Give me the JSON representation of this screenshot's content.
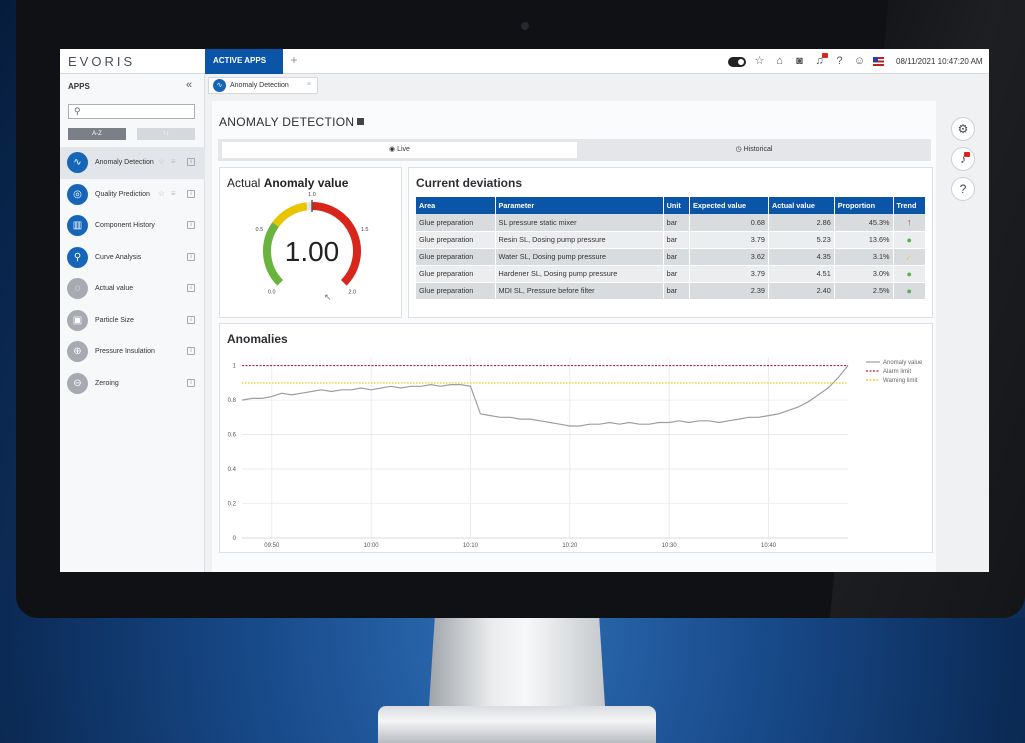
{
  "topbar": {
    "brand": "EVORIS",
    "active_tab": "ACTIVE APPS",
    "add_tab": "+",
    "datetime": "08/11/2021 10:47:20 AM",
    "icons": [
      "toggle-icon",
      "star-icon",
      "home-icon",
      "camera-icon",
      "notification-icon",
      "help-icon",
      "user-icon",
      "flag-icon"
    ]
  },
  "sidebar": {
    "title": "APPS",
    "collapse": "«",
    "sort_az": "A-Z",
    "sort_alt": "↑↓",
    "items": [
      {
        "label": "Anomaly Detection",
        "icon": "anomaly-icon",
        "active": true
      },
      {
        "label": "Quality Prediction",
        "icon": "quality-icon"
      },
      {
        "label": "Component History",
        "icon": "component-history-icon"
      },
      {
        "label": "Curve Analysis",
        "icon": "curve-analysis-icon"
      },
      {
        "label": "Actual value",
        "icon": "actual-value-icon",
        "grey": true
      },
      {
        "label": "Particle Size",
        "icon": "particle-size-icon",
        "grey": true
      },
      {
        "label": "Pressure Insulation",
        "icon": "pressure-insulation-icon",
        "grey": true
      },
      {
        "label": "Zeroing",
        "icon": "zeroing-icon",
        "grey": true
      }
    ]
  },
  "subtab": {
    "label": "Anomaly Detection",
    "close": "×"
  },
  "page": {
    "title": "ANOMALY DETECTION",
    "mode_live": "Live",
    "mode_historical": "Historical"
  },
  "gauge": {
    "title_prefix": "Actual ",
    "title_bold": "Anomaly value",
    "value_text": "1.00",
    "value": 1.0,
    "min": 0.0,
    "max": 2.0,
    "ticks": [
      "0.0",
      "0.5",
      "1.0",
      "1.5",
      "2.0"
    ],
    "colors": {
      "low": "#6ab43e",
      "mid": "#e9c500",
      "high": "#d9261c",
      "track": "#e2e4e7"
    }
  },
  "deviations": {
    "title": "Current deviations",
    "columns": [
      "Area",
      "Parameter",
      "Unit",
      "Expected value",
      "Actual value",
      "Proportion",
      "Trend"
    ],
    "rows": [
      {
        "area": "Glue preparation",
        "parameter": "SL pressure static mixer",
        "unit": "bar",
        "expected": "0.68",
        "actual": "2.86",
        "proportion": "45.3%",
        "trend": "up"
      },
      {
        "area": "Glue preparation",
        "parameter": "Resin SL, Dosing pump pressure",
        "unit": "bar",
        "expected": "3.79",
        "actual": "5.23",
        "proportion": "13.6%",
        "trend": "dot"
      },
      {
        "area": "Glue preparation",
        "parameter": "Water SL, Dosing pump pressure",
        "unit": "bar",
        "expected": "3.62",
        "actual": "4.35",
        "proportion": "3.1%",
        "trend": "diag"
      },
      {
        "area": "Glue preparation",
        "parameter": "Hardener SL, Dosing pump pressure",
        "unit": "bar",
        "expected": "3.79",
        "actual": "4.51",
        "proportion": "3.0%",
        "trend": "dot"
      },
      {
        "area": "Glue preparation",
        "parameter": "MDI SL, Pressure before filter",
        "unit": "bar",
        "expected": "2.39",
        "actual": "2.40",
        "proportion": "2.5%",
        "trend": "dot"
      }
    ]
  },
  "chart_data": {
    "type": "line",
    "title": "Anomalies",
    "xlabel": "",
    "ylabel": "",
    "x_ticks": [
      "09:50",
      "10:00",
      "10:10",
      "10:20",
      "10:30",
      "10:40"
    ],
    "x_range_minutes": [
      47,
      108
    ],
    "x_tick_minutes": [
      50,
      60,
      70,
      80,
      90,
      100
    ],
    "ylim": [
      0,
      1.05
    ],
    "y_ticks": [
      "0",
      "0.2",
      "0.4",
      "0.6",
      "0.8",
      "1"
    ],
    "grid": true,
    "legend_position": "right",
    "series": [
      {
        "name": "Anomaly value",
        "color": "#9a9ea4",
        "x": [
          47,
          48,
          49,
          50,
          51,
          52,
          53,
          54,
          55,
          56,
          57,
          58,
          59,
          60,
          61,
          62,
          63,
          64,
          65,
          66,
          67,
          68,
          69,
          70,
          70.5,
          71,
          72,
          73,
          74,
          75,
          76,
          77,
          78,
          79,
          80,
          81,
          82,
          83,
          84,
          85,
          86,
          87,
          88,
          89,
          90,
          91,
          92,
          93,
          94,
          95,
          96,
          97,
          98,
          99,
          100,
          101,
          102,
          103,
          104,
          105,
          106,
          107,
          108
        ],
        "values": [
          0.8,
          0.81,
          0.81,
          0.82,
          0.84,
          0.83,
          0.84,
          0.85,
          0.86,
          0.85,
          0.86,
          0.86,
          0.87,
          0.86,
          0.87,
          0.88,
          0.87,
          0.88,
          0.88,
          0.89,
          0.88,
          0.89,
          0.89,
          0.88,
          0.8,
          0.72,
          0.71,
          0.7,
          0.7,
          0.69,
          0.69,
          0.68,
          0.67,
          0.66,
          0.65,
          0.65,
          0.66,
          0.66,
          0.67,
          0.66,
          0.67,
          0.66,
          0.66,
          0.67,
          0.67,
          0.68,
          0.67,
          0.68,
          0.68,
          0.67,
          0.68,
          0.69,
          0.7,
          0.7,
          0.71,
          0.72,
          0.74,
          0.76,
          0.79,
          0.83,
          0.87,
          0.93,
          1.0
        ]
      },
      {
        "name": "Alarm limit",
        "color": "#b0244f",
        "dash": true,
        "x": [
          47,
          108
        ],
        "values": [
          1.0,
          1.0
        ]
      },
      {
        "name": "Warning limit",
        "color": "#e9c500",
        "dash": true,
        "x": [
          47,
          108
        ],
        "values": [
          0.9,
          0.9
        ]
      }
    ]
  },
  "tools": [
    "settings-icon",
    "alarm-bell-icon",
    "help-icon"
  ]
}
